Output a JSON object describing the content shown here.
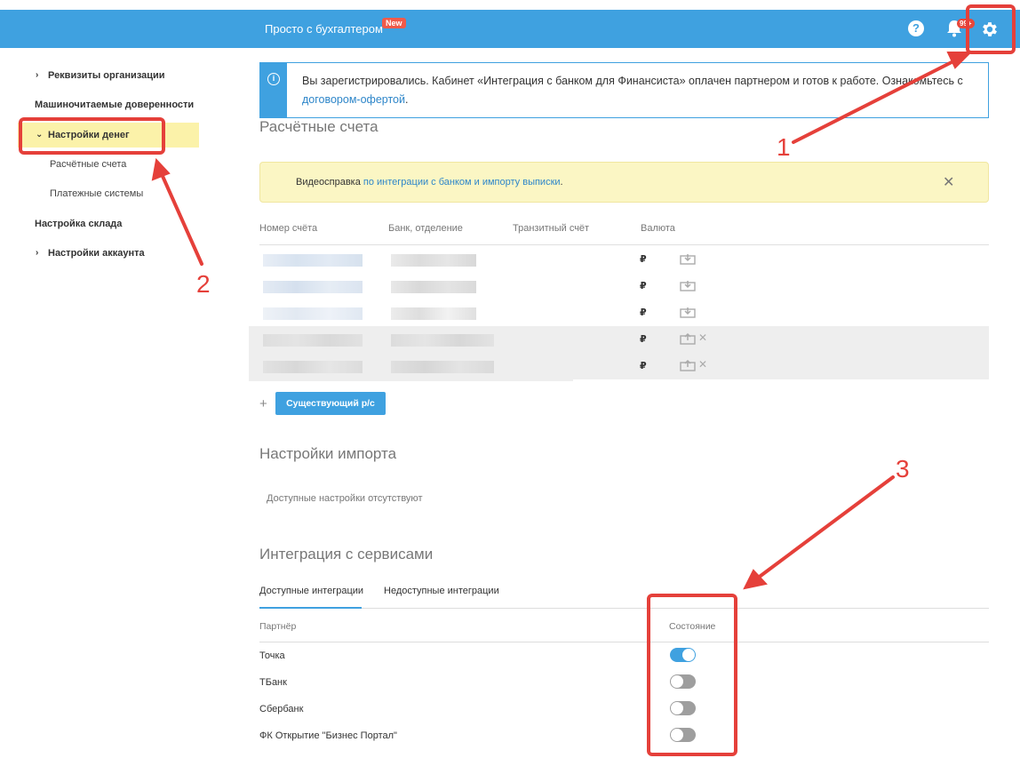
{
  "header": {
    "brand": "Просто с бухгалтером",
    "new_badge": "New",
    "help_label": "?",
    "notifications_badge": "99+",
    "accent_color": "#3fa1e0"
  },
  "sidebar": {
    "items": [
      {
        "label": "Реквизиты организации"
      },
      {
        "label": "Машиночитаемые доверенности"
      },
      {
        "label": "Настройки денег"
      },
      {
        "label": "Расчётные счета"
      },
      {
        "label": "Платежные системы"
      },
      {
        "label": "Настройка склада"
      },
      {
        "label": "Настройки аккаунта"
      }
    ]
  },
  "info": {
    "text": "Вы зарегистрировались. Кабинет «Интеграция с банком для Финансиста» оплачен партнером и готов к работе. Ознакомьтесь с ",
    "link": "договором-офертой",
    "tail": "."
  },
  "accounts": {
    "title": "Расчётные счета",
    "video_prefix": "Видеосправка ",
    "video_link": "по интеграции с банком и импорту выписки",
    "video_suffix": ".",
    "columns": [
      "Номер счёта",
      "Банк, отделение",
      "Транзитный счёт",
      "Валюта"
    ],
    "rows": [
      {
        "currency": "₽"
      },
      {
        "currency": "₽"
      },
      {
        "currency": "₽"
      },
      {
        "currency": "₽"
      },
      {
        "currency": "₽"
      }
    ],
    "add_button": "Существующий р/с",
    "add_plus": "+"
  },
  "import": {
    "title": "Настройки импорта",
    "empty": "Доступные настройки отсутствуют"
  },
  "integrations": {
    "title": "Интеграция с сервисами",
    "tabs": [
      "Доступные интеграции",
      "Недоступные интеграции"
    ],
    "col_partner": "Партнёр",
    "col_state": "Состояние",
    "partners": [
      {
        "name": "Точка",
        "enabled": true
      },
      {
        "name": "ТБанк",
        "enabled": false
      },
      {
        "name": "Сбербанк",
        "enabled": false
      },
      {
        "name": "ФК Открытие \"Бизнес Портал\"",
        "enabled": false
      }
    ]
  },
  "annotations": {
    "labels": [
      "1",
      "2",
      "3"
    ],
    "color": "#e5403a"
  }
}
